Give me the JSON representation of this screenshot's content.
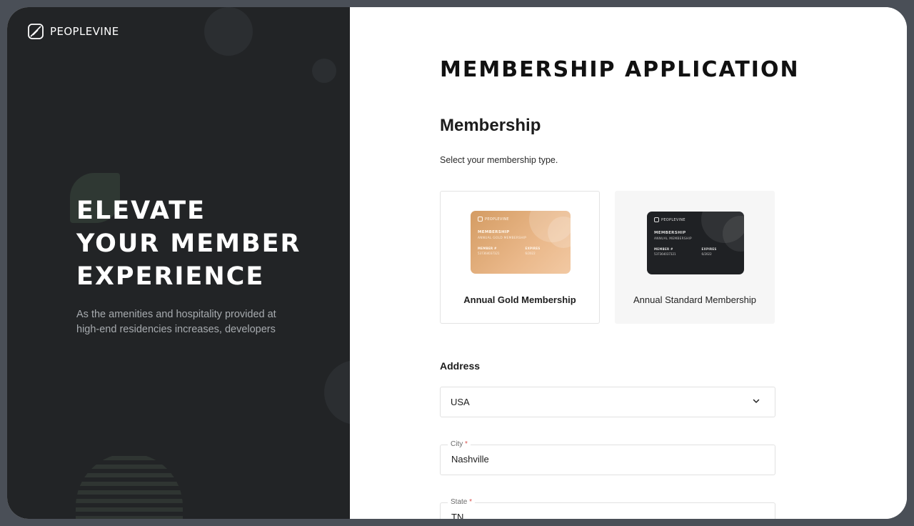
{
  "brand": {
    "name": "PEOPLEVINE"
  },
  "hero": {
    "lines": [
      "ELEVATE",
      "YOUR MEMBER",
      "EXPERIENCE"
    ],
    "subtitle": "As the amenities and hospitality provided at high-end residencies increases, developers"
  },
  "form": {
    "title": "MEMBERSHIP APPLICATION",
    "membership": {
      "heading": "Membership",
      "description": "Select your membership type.",
      "options": [
        {
          "label": "Annual Gold Membership",
          "card": {
            "brand": "PEOPLEVINE",
            "title": "MEMBERSHIP",
            "subtitle": "ANNUAL GOLD MEMBERSHIP",
            "member_key": "MEMBER #",
            "member_value": "537364037321",
            "expires_key": "EXPIRES",
            "expires_value": "6/2022"
          }
        },
        {
          "label": "Annual Standard Membership",
          "card": {
            "brand": "PEOPLEVINE",
            "title": "MEMBERSHIP",
            "subtitle": "ANNUAL MEMBERSHIP",
            "member_key": "MEMBER #",
            "member_value": "537364037321",
            "expires_key": "EXPIRES",
            "expires_value": "6/2022"
          }
        }
      ]
    },
    "address": {
      "heading": "Address",
      "country": {
        "value": "USA"
      },
      "city": {
        "label": "City",
        "required_mark": "*",
        "value": "Nashville"
      },
      "state": {
        "label": "State",
        "required_mark": "*",
        "value": "TN"
      }
    }
  },
  "colors": {
    "left_panel": "#222426",
    "gold_card": "#e3ad7b",
    "dark_card": "#1f2124",
    "required": "#d9534f"
  },
  "icons": {
    "brand": "leaf-logo-icon",
    "select": "chevron-down-icon"
  }
}
